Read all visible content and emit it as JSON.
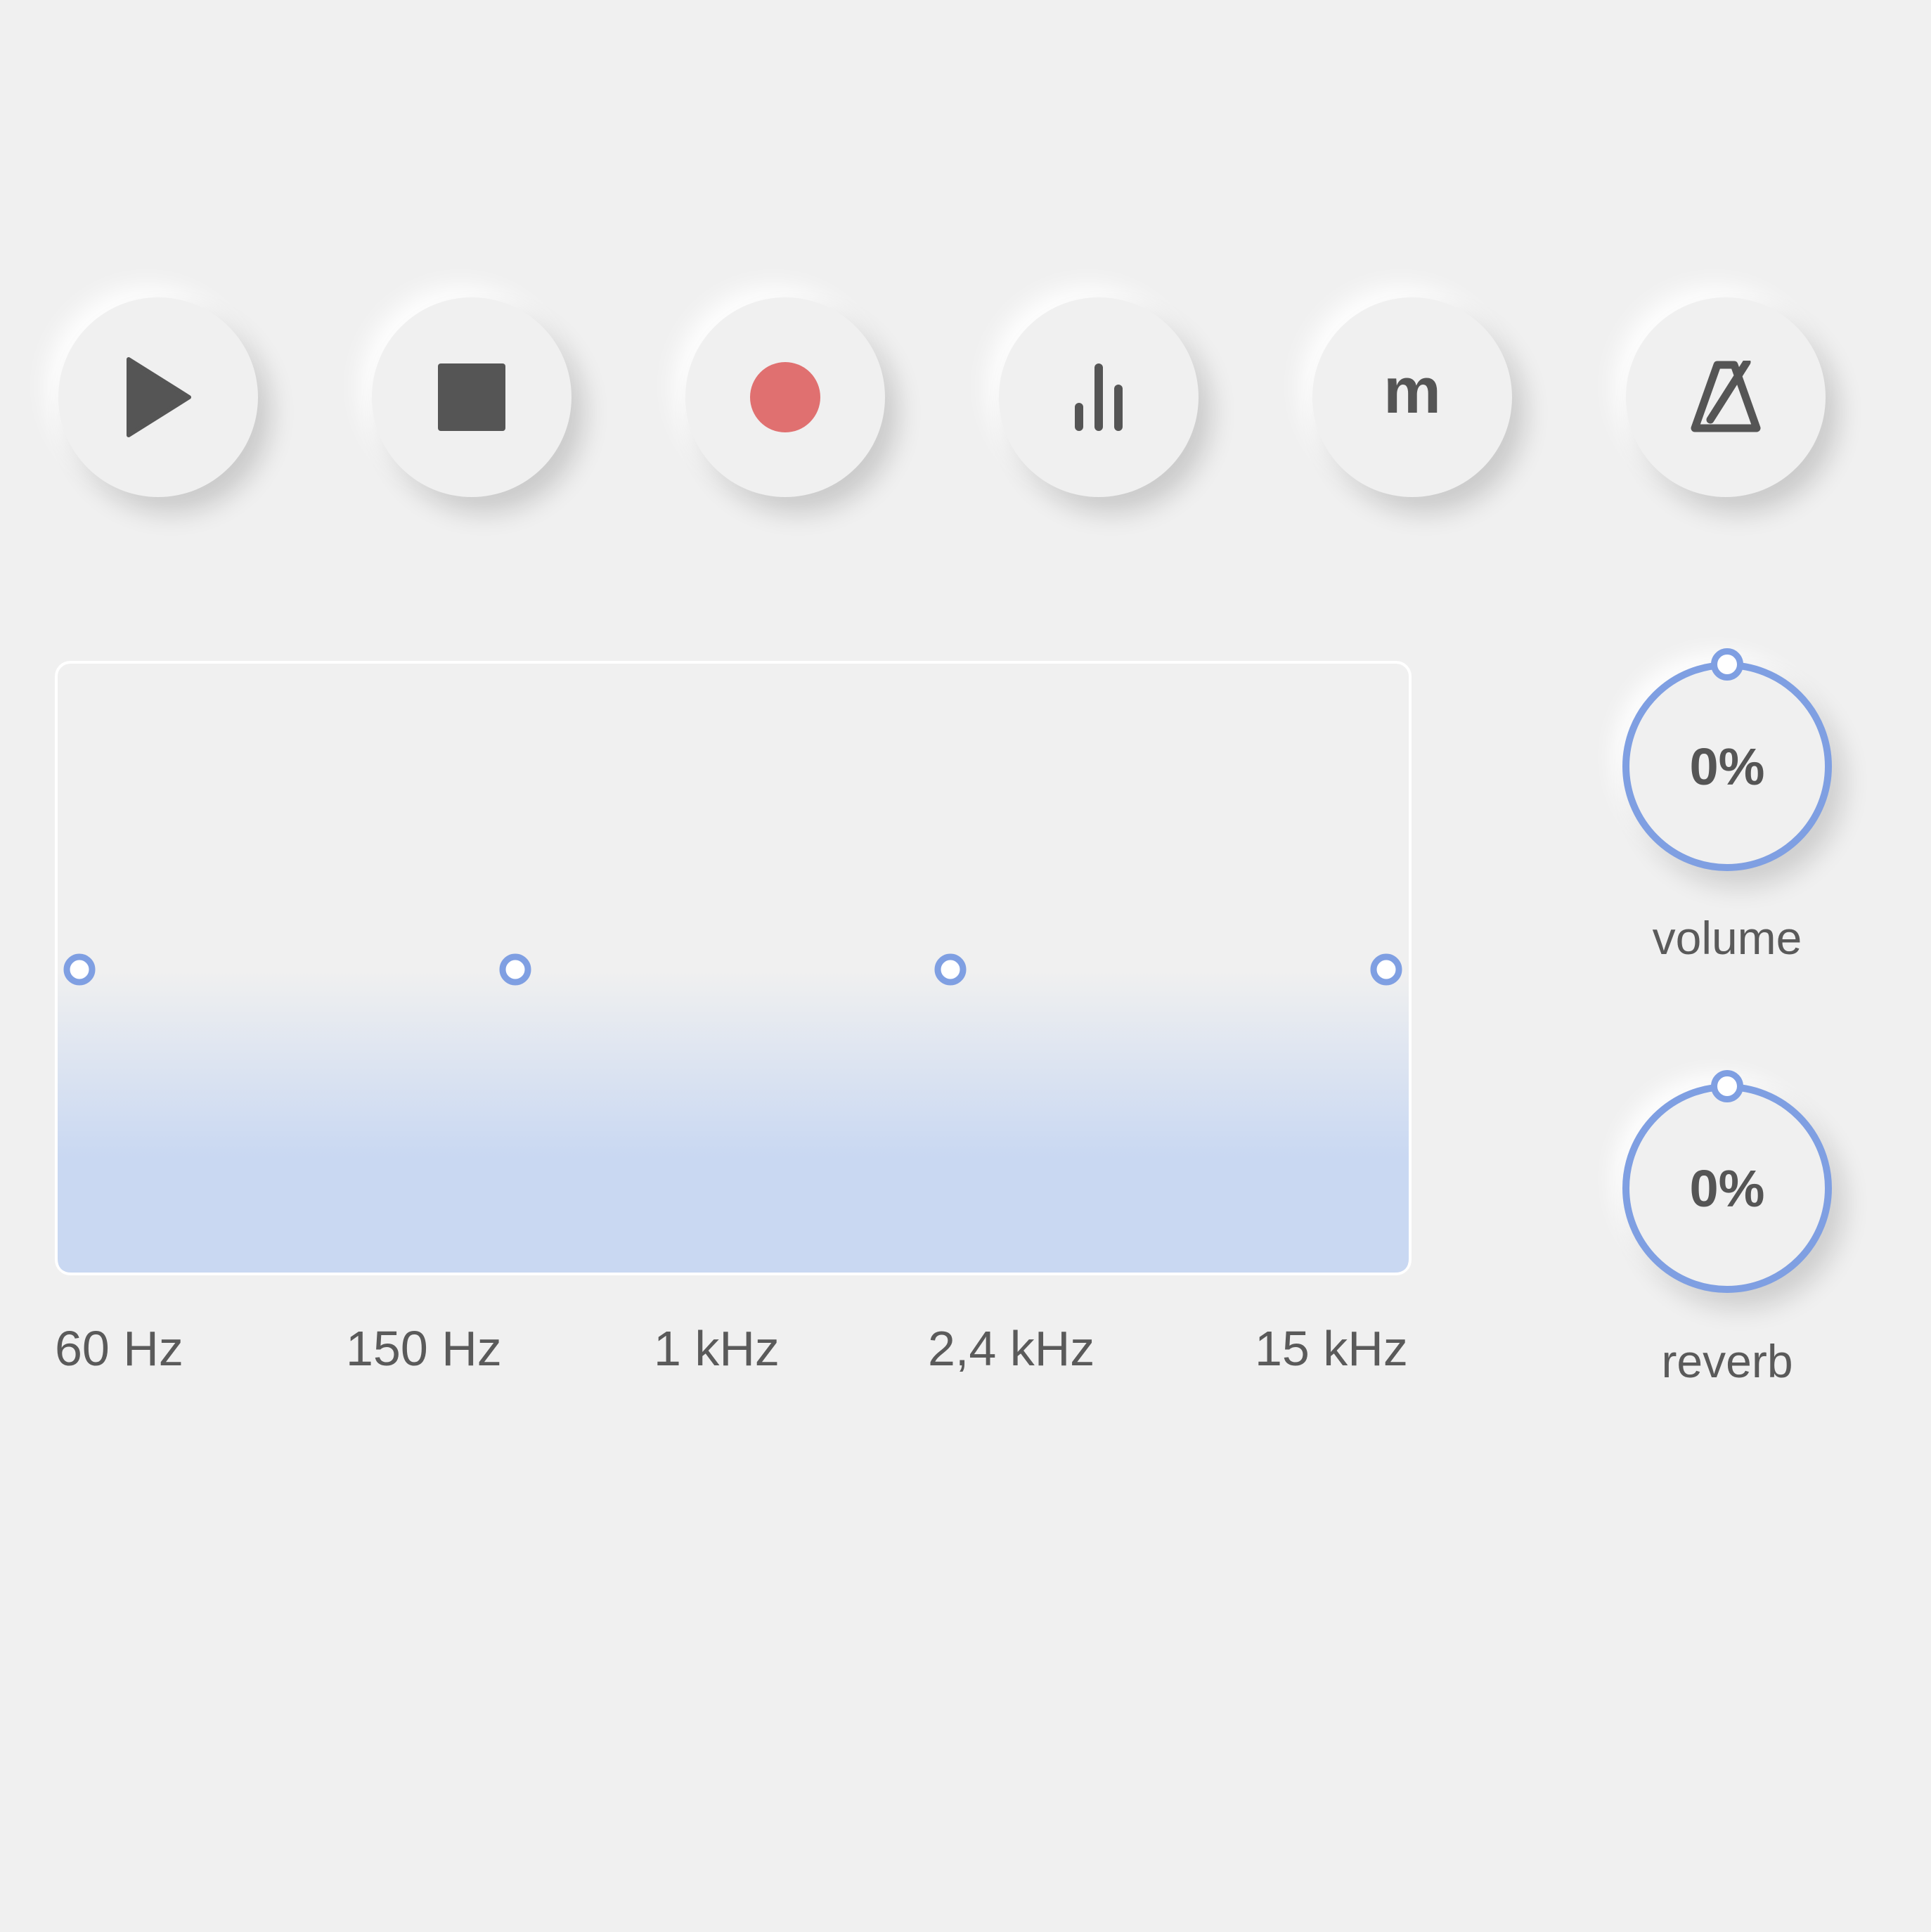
{
  "controls": {
    "buttons": [
      {
        "id": "play",
        "icon": "play-icon"
      },
      {
        "id": "stop",
        "icon": "stop-icon"
      },
      {
        "id": "record",
        "icon": "record-icon"
      },
      {
        "id": "equalizer",
        "icon": "bar-chart-icon"
      },
      {
        "id": "m",
        "icon": "letter-m-icon",
        "text": "m"
      },
      {
        "id": "metronome",
        "icon": "metronome-icon"
      }
    ],
    "colors": {
      "icon": "#555555",
      "record": "#e07070",
      "accent": "#7f9fe2",
      "fill": "#c9d8f2",
      "background": "#f0f0f0"
    }
  },
  "equalizer": {
    "bands": [
      "60 Hz",
      "150 Hz",
      "1 kHz",
      "2,4 kHz",
      "15 kHz"
    ],
    "gain_level": 0.5
  },
  "knobs": {
    "volume": {
      "value": "0%",
      "label": "volume",
      "level": 0
    },
    "reverb": {
      "value": "0%",
      "label": "reverb",
      "level": 0
    }
  }
}
